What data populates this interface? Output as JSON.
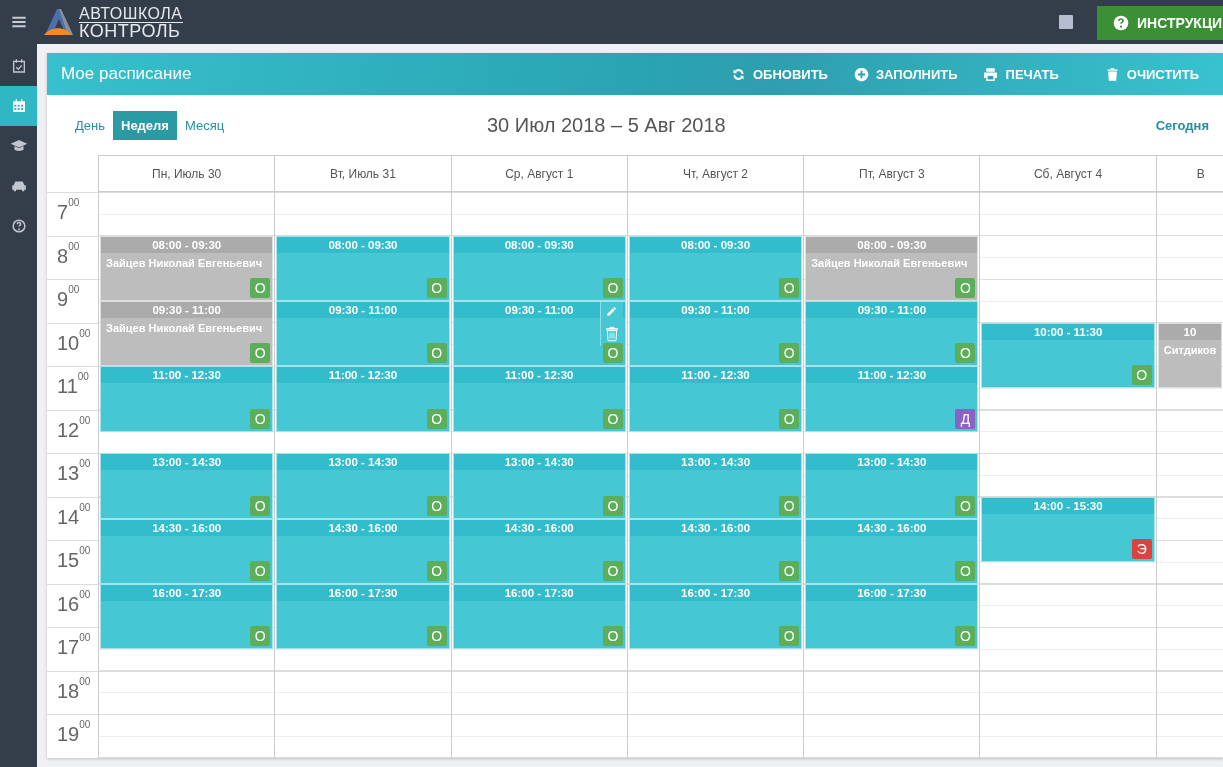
{
  "topbar": {
    "logo": {
      "line1": "АВТОШКОЛА",
      "line2": "КОНТРОЛЬ"
    },
    "help_button": "ИНСТРУКЦИ"
  },
  "sidebar": {
    "items": [
      {
        "selected": false
      },
      {
        "selected": true
      },
      {
        "selected": false
      },
      {
        "selected": false
      },
      {
        "selected": false
      }
    ]
  },
  "card": {
    "title": "Мое расписание",
    "actions": [
      {
        "label": "ОБНОВИТЬ"
      },
      {
        "label": "ЗАПОЛНИТЬ"
      },
      {
        "label": "ПЕЧАТЬ"
      },
      {
        "label": "ОЧИСТИТЬ"
      }
    ]
  },
  "views": [
    {
      "label": "День",
      "selected": false
    },
    {
      "label": "Неделя",
      "selected": true
    },
    {
      "label": "Месяц",
      "selected": false
    }
  ],
  "date_range": "30 Июл 2018 – 5 Авг 2018",
  "today_button": "Сегодня",
  "hours": [
    "7$^{00}$",
    "8$^{00}$",
    "9$^{00}$",
    "10$^{00}$",
    "11$^{00}$",
    "12$^{00}$",
    "13$^{00}$",
    "14$^{00}$",
    "15$^{00}$",
    "16$^{00}$",
    "17$^{00}$",
    "18$^{00}$",
    "19$^{00}$"
  ],
  "days": [
    {
      "label": "Пн, Июль 30",
      "events": [
        {
          "time": "08:00 - 09:30",
          "kind": "booked",
          "name": "Зайцев Николай Евгеньевич",
          "hovered": false,
          "badge": {
            "label": "О",
            "color": "#5cae5a"
          }
        },
        {
          "time": "09:30 - 11:00",
          "kind": "booked",
          "name": "Зайцев Николай Евгеньевич",
          "hovered": false,
          "badge": {
            "label": "О",
            "color": "#5cae5a"
          }
        },
        {
          "time": "11:00 - 12:30",
          "kind": "open",
          "hovered": false,
          "badge": {
            "label": "О",
            "color": "#5cae5a"
          }
        },
        {
          "time": "13:00 - 14:30",
          "kind": "open",
          "hovered": false,
          "badge": {
            "label": "О",
            "color": "#5cae5a"
          }
        },
        {
          "time": "14:30 - 16:00",
          "kind": "open",
          "hovered": false,
          "badge": {
            "label": "О",
            "color": "#5cae5a"
          }
        },
        {
          "time": "16:00 - 17:30",
          "kind": "open",
          "hovered": false,
          "badge": {
            "label": "О",
            "color": "#5cae5a"
          }
        }
      ]
    },
    {
      "label": "Вт, Июль 31",
      "events": [
        {
          "time": "08:00 - 09:30",
          "kind": "open",
          "hovered": false,
          "badge": {
            "label": "О",
            "color": "#5cae5a"
          }
        },
        {
          "time": "09:30 - 11:00",
          "kind": "open",
          "hovered": false,
          "badge": {
            "label": "О",
            "color": "#5cae5a"
          }
        },
        {
          "time": "11:00 - 12:30",
          "kind": "open",
          "hovered": false,
          "badge": {
            "label": "О",
            "color": "#5cae5a"
          }
        },
        {
          "time": "13:00 - 14:30",
          "kind": "open",
          "hovered": false,
          "badge": {
            "label": "О",
            "color": "#5cae5a"
          }
        },
        {
          "time": "14:30 - 16:00",
          "kind": "open",
          "hovered": false,
          "badge": {
            "label": "О",
            "color": "#5cae5a"
          }
        },
        {
          "time": "16:00 - 17:30",
          "kind": "open",
          "hovered": false,
          "badge": {
            "label": "О",
            "color": "#5cae5a"
          }
        }
      ]
    },
    {
      "label": "Ср, Август 1",
      "events": [
        {
          "time": "08:00 - 09:30",
          "kind": "open",
          "hovered": false,
          "badge": {
            "label": "О",
            "color": "#5cae5a"
          }
        },
        {
          "time": "09:30 - 11:00",
          "kind": "open",
          "hovered": true,
          "badge": {
            "label": "О",
            "color": "#5cae5a"
          }
        },
        {
          "time": "11:00 - 12:30",
          "kind": "open",
          "hovered": false,
          "badge": {
            "label": "О",
            "color": "#5cae5a"
          }
        },
        {
          "time": "13:00 - 14:30",
          "kind": "open",
          "hovered": false,
          "badge": {
            "label": "О",
            "color": "#5cae5a"
          }
        },
        {
          "time": "14:30 - 16:00",
          "kind": "open",
          "hovered": false,
          "badge": {
            "label": "О",
            "color": "#5cae5a"
          }
        },
        {
          "time": "16:00 - 17:30",
          "kind": "open",
          "hovered": false,
          "badge": {
            "label": "О",
            "color": "#5cae5a"
          }
        }
      ]
    },
    {
      "label": "Чт, Август 2",
      "events": [
        {
          "time": "08:00 - 09:30",
          "kind": "open",
          "hovered": false,
          "badge": {
            "label": "О",
            "color": "#5cae5a"
          }
        },
        {
          "time": "09:30 - 11:00",
          "kind": "open",
          "hovered": false,
          "badge": {
            "label": "О",
            "color": "#5cae5a"
          }
        },
        {
          "time": "11:00 - 12:30",
          "kind": "open",
          "hovered": false,
          "badge": {
            "label": "О",
            "color": "#5cae5a"
          }
        },
        {
          "time": "13:00 - 14:30",
          "kind": "open",
          "hovered": false,
          "badge": {
            "label": "О",
            "color": "#5cae5a"
          }
        },
        {
          "time": "14:30 - 16:00",
          "kind": "open",
          "hovered": false,
          "badge": {
            "label": "О",
            "color": "#5cae5a"
          }
        },
        {
          "time": "16:00 - 17:30",
          "kind": "open",
          "hovered": false,
          "badge": {
            "label": "О",
            "color": "#5cae5a"
          }
        }
      ]
    },
    {
      "label": "Пт, Август 3",
      "events": [
        {
          "time": "08:00 - 09:30",
          "kind": "booked",
          "name": "Зайцев Николай Евгеньевич",
          "hovered": false,
          "badge": {
            "label": "О",
            "color": "#5cae5a"
          }
        },
        {
          "time": "09:30 - 11:00",
          "kind": "open",
          "hovered": false,
          "badge": {
            "label": "О",
            "color": "#5cae5a"
          }
        },
        {
          "time": "11:00 - 12:30",
          "kind": "open",
          "hovered": false,
          "badge": {
            "label": "Д",
            "color": "#8a63c2"
          }
        },
        {
          "time": "13:00 - 14:30",
          "kind": "open",
          "hovered": false,
          "badge": {
            "label": "О",
            "color": "#5cae5a"
          }
        },
        {
          "time": "14:30 - 16:00",
          "kind": "open",
          "hovered": false,
          "badge": {
            "label": "О",
            "color": "#5cae5a"
          }
        },
        {
          "time": "16:00 - 17:30",
          "kind": "open",
          "hovered": false,
          "badge": {
            "label": "О",
            "color": "#5cae5a"
          }
        }
      ]
    },
    {
      "label": "Сб, Август 4",
      "events": [
        {
          "time": "10:00 - 11:30",
          "kind": "open",
          "hovered": false,
          "badge": {
            "label": "О",
            "color": "#5cae5a"
          }
        },
        {
          "time": "14:00 - 15:30",
          "kind": "open",
          "hovered": false,
          "badge": {
            "label": "Э",
            "color": "#d9443f"
          }
        }
      ]
    },
    {
      "label": "В",
      "events": [
        {
          "time": "10",
          "kind": "booked",
          "name": "Ситдиков",
          "hovered": false
        }
      ]
    }
  ]
}
